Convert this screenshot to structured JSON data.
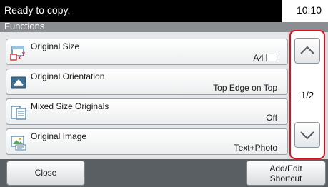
{
  "status": {
    "message": "Ready to copy.",
    "time": "10:10"
  },
  "header": {
    "title": "Functions"
  },
  "functions": [
    {
      "label": "Original Size",
      "value": "A4",
      "icon": "original-size-icon",
      "value_icon": "paper-size-icon"
    },
    {
      "label": "Original Orientation",
      "value": "Top Edge on Top",
      "icon": "original-orientation-icon"
    },
    {
      "label": "Mixed Size Originals",
      "value": "Off",
      "icon": "mixed-size-originals-icon"
    },
    {
      "label": "Original Image",
      "value": "Text+Photo",
      "icon": "original-image-icon"
    }
  ],
  "pager": {
    "indicator": "1/2",
    "up_icon": "chevron-up-icon",
    "down_icon": "chevron-down-icon"
  },
  "footer": {
    "close_label": "Close",
    "shortcut_line1": "Add/Edit",
    "shortcut_line2": "Shortcut"
  },
  "colors": {
    "status_bar": "#000000",
    "header": "#8a8e93",
    "highlight_border": "#d4121d",
    "footer": "#5a5f64"
  }
}
